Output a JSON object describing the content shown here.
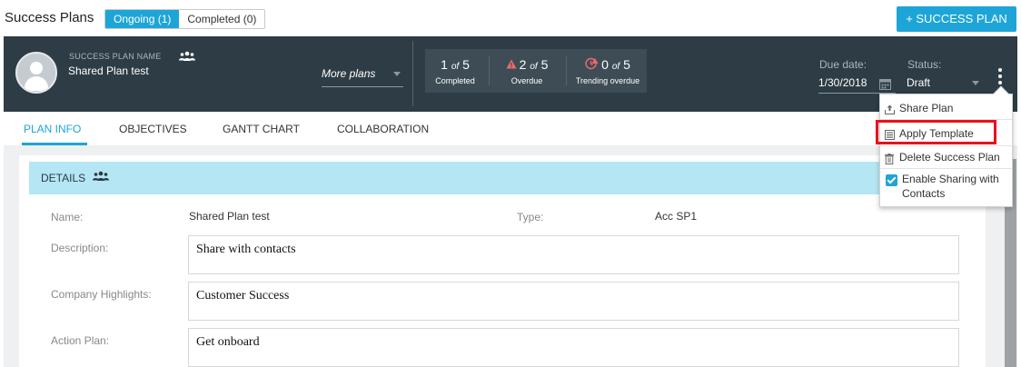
{
  "topbar": {
    "title": "Success Plans",
    "tabs": [
      {
        "label": "Ongoing (1)",
        "active": true
      },
      {
        "label": "Completed (0)",
        "active": false
      }
    ],
    "add_button": "+ SUCCESS PLAN"
  },
  "plan_header": {
    "name_label": "SUCCESS PLAN NAME",
    "name": "Shared Plan test",
    "more_plans": "More plans",
    "stats": [
      {
        "value": "1",
        "of": "of",
        "total": "5",
        "label": "Completed"
      },
      {
        "value": "2",
        "of": "of",
        "total": "5",
        "label": "Overdue"
      },
      {
        "value": "0",
        "of": "of",
        "total": "5",
        "label": "Trending overdue"
      }
    ],
    "due_label": "Due date:",
    "due_value": "1/30/2018",
    "status_label": "Status:",
    "status_value": "Draft"
  },
  "tabs": [
    {
      "label": "PLAN INFO",
      "active": true
    },
    {
      "label": "OBJECTIVES",
      "active": false
    },
    {
      "label": "GANTT CHART",
      "active": false
    },
    {
      "label": "COLLABORATION",
      "active": false
    }
  ],
  "details": {
    "title": "DETAILS",
    "name_label": "Name:",
    "name_value": "Shared Plan test",
    "type_label": "Type:",
    "type_value": "Acc SP1",
    "description_label": "Description:",
    "description_value": "Share with contacts",
    "highlights_label": "Company Highlights:",
    "highlights_value": "Customer Success",
    "action_label": "Action Plan:",
    "action_value": "Get onboard"
  },
  "menu": {
    "items": [
      {
        "label": "Share Plan",
        "icon": "share-icon"
      },
      {
        "label": "Apply Template",
        "icon": "template-icon"
      },
      {
        "label": "Delete Success Plan",
        "icon": "trash-icon"
      },
      {
        "label": "Enable Sharing with",
        "label2": "Contacts",
        "icon": "checkbox-icon",
        "checked": true
      }
    ]
  },
  "colors": {
    "accent": "#1ea5d7",
    "header": "#2e3d45",
    "details_bar": "#b4e6f4",
    "highlight": "#e8121d",
    "warning": "#f0686c"
  }
}
